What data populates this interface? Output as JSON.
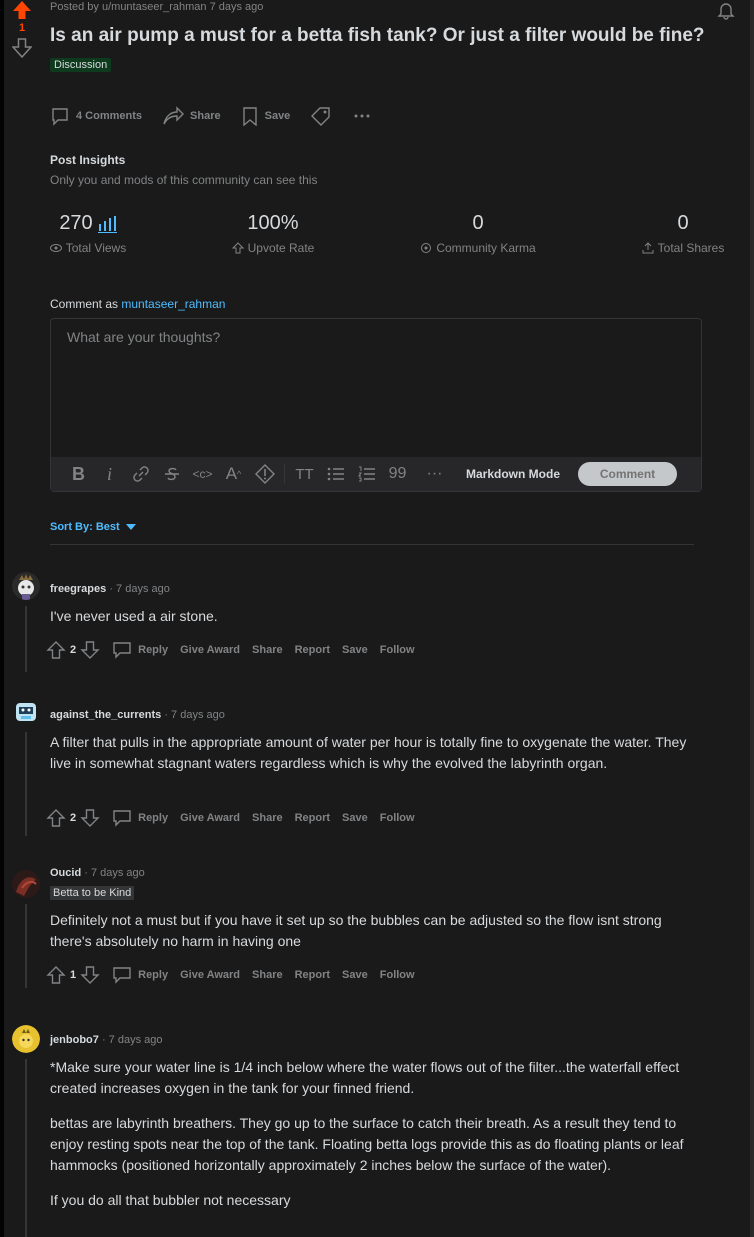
{
  "post": {
    "score": "1",
    "meta": "Posted by u/muntaseer_rahman 7 days ago",
    "title": "Is an air pump a must for a betta fish tank? Or just a filter would be fine?",
    "flair": "Discussion",
    "actions": {
      "comments": "4 Comments",
      "share": "Share",
      "save": "Save"
    }
  },
  "insights": {
    "title": "Post Insights",
    "subtitle": "Only you and mods of this community can see this",
    "stats": [
      {
        "value": "270",
        "label": "Total Views"
      },
      {
        "value": "100%",
        "label": "Upvote Rate"
      },
      {
        "value": "0",
        "label": "Community Karma"
      },
      {
        "value": "0",
        "label": "Total Shares"
      }
    ]
  },
  "composer": {
    "comment_as_label": "Comment as",
    "username": "muntaseer_rahman",
    "placeholder": "What are your thoughts?",
    "markdown_mode": "Markdown Mode",
    "comment_button": "Comment",
    "toolbar_icons": [
      "bold-icon",
      "italic-icon",
      "link-icon",
      "strikethrough-icon",
      "inline-code-icon",
      "superscript-icon",
      "spoiler-icon",
      "heading-icon",
      "bulleted-list-icon",
      "numbered-list-icon",
      "quote-icon",
      "more-icon"
    ]
  },
  "sort": {
    "label": "Sort By: Best"
  },
  "comment_actions": {
    "reply": "Reply",
    "give_award": "Give Award",
    "share": "Share",
    "report": "Report",
    "save": "Save",
    "follow": "Follow"
  },
  "comments": [
    {
      "user": "freegrapes",
      "time": "· 7 days ago",
      "flair": "",
      "body": [
        "I've never used a air stone."
      ],
      "votes": "2"
    },
    {
      "user": "against_the_currents",
      "time": "· 7 days ago",
      "flair": "",
      "body": [
        "A filter that pulls in the appropriate amount of water per hour is totally fine to oxygenate the water. They live in somewhat stagnant waters regardless which is why the evolved the labyrinth organ."
      ],
      "votes": "2"
    },
    {
      "user": "Oucid",
      "time": "· 7 days ago",
      "flair": "Betta to be Kind",
      "body": [
        "Definitely not a must but if you have it set up so the bubbles can be adjusted so the flow isnt strong there's absolutely no harm in having one"
      ],
      "votes": "1"
    },
    {
      "user": "jenbobo7",
      "time": "· 7 days ago",
      "flair": "",
      "body": [
        "*Make sure your water line is 1/4 inch below where the water flows out of the filter...the waterfall effect created increases oxygen in the tank for your finned friend.",
        "bettas are labyrinth breathers. They go up to the surface to catch their breath. As a result they tend to enjoy resting spots near the top of the tank. Floating betta logs provide this as do floating plants or leaf hammocks (positioned horizontally approximately 2 inches below the surface of the water).",
        "If you do all that bubbler not necessary"
      ],
      "votes": ""
    }
  ],
  "colors": {
    "background": "#1a1a1b",
    "upvote": "#ff4500",
    "link": "#4fbcff",
    "flair_green": "#0e3b1d"
  }
}
